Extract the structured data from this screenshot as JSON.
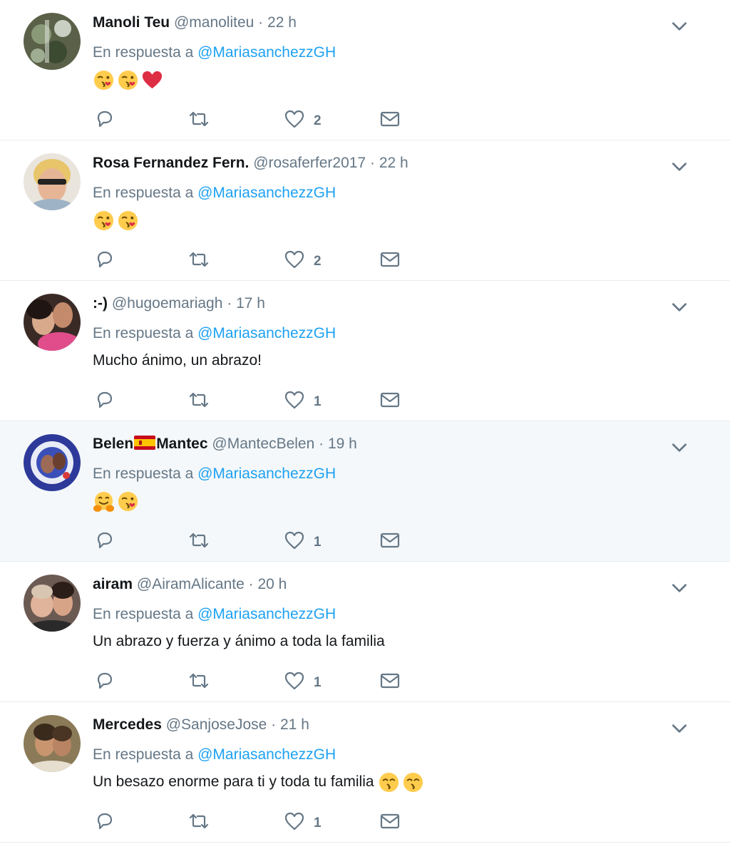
{
  "reply_prefix": "En respuesta a",
  "reply_target": "@MariasanchezzGH",
  "colors": {
    "link": "#1da1f2",
    "muted": "#657786",
    "text": "#14171a",
    "divider": "#e6ecf0",
    "highlight_bg": "#f5f8fa"
  },
  "tweets": [
    {
      "name": "Manoli Teu",
      "handle": "@manoliteu",
      "dot": "·",
      "time": "22 h",
      "text": "",
      "emojis": [
        "face-blowing-kiss",
        "face-blowing-kiss",
        "red-heart"
      ],
      "likes": "2"
    },
    {
      "name": "Rosa Fernandez Fern.",
      "handle": "@rosaferfer2017",
      "dot": "·",
      "time": "22 h",
      "text": "",
      "emojis": [
        "face-blowing-kiss",
        "face-blowing-kiss"
      ],
      "likes": "2"
    },
    {
      "name": ":-)",
      "handle": "@hugoemariagh",
      "dot": "·",
      "time": "17 h",
      "text": "Mucho ánimo, un abrazo!",
      "emojis": [],
      "likes": "1"
    },
    {
      "name_part1": "Belen",
      "name_part2": "Mantec",
      "name_flag": "spain-flag",
      "handle": "@MantecBelen",
      "dot": "·",
      "time": "19 h",
      "text": "",
      "emojis": [
        "hugging-face",
        "face-blowing-kiss"
      ],
      "likes": "1"
    },
    {
      "name": "airam",
      "handle": "@AiramAlicante",
      "dot": "·",
      "time": "20 h",
      "text": "Un abrazo y fuerza y ánimo a toda la familia",
      "emojis": [],
      "likes": "1"
    },
    {
      "name": "Mercedes",
      "handle": "@SanjoseJose",
      "dot": "·",
      "time": "21 h",
      "text": "Un besazo enorme para ti y toda tu familia",
      "emojis": [
        "kissing-face-smiling-eyes",
        "kissing-face-smiling-eyes"
      ],
      "likes": "1"
    }
  ]
}
